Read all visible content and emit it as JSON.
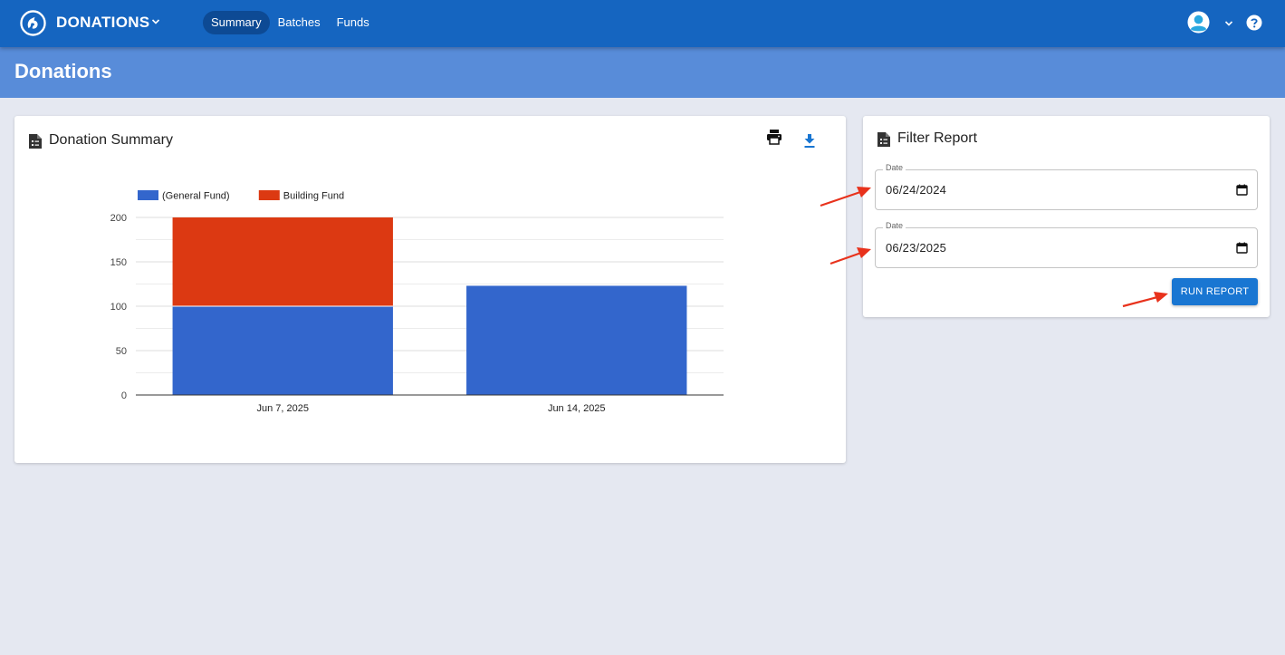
{
  "app": {
    "name": "DONATIONS"
  },
  "nav": {
    "items": [
      {
        "label": "Summary",
        "active": true
      },
      {
        "label": "Batches",
        "active": false
      },
      {
        "label": "Funds",
        "active": false
      }
    ]
  },
  "page": {
    "title": "Donations"
  },
  "summary": {
    "title": "Donation Summary"
  },
  "filter": {
    "title": "Filter Report",
    "start": {
      "label": "Date",
      "value": "06/24/2024"
    },
    "end": {
      "label": "Date",
      "value": "06/23/2025"
    },
    "run_label": "RUN REPORT"
  },
  "colors": {
    "topbar": "#1565c0",
    "subbar": "#588cd9",
    "series1": "#3366cc",
    "series2": "#dc3912",
    "button": "#1976d2",
    "annotation": "#e8321c"
  },
  "chart_data": {
    "type": "bar",
    "stacked": true,
    "categories": [
      "Jun 7, 2025",
      "Jun 14, 2025"
    ],
    "series": [
      {
        "name": "(General Fund)",
        "values": [
          100,
          123
        ],
        "color": "#3366cc"
      },
      {
        "name": "Building Fund",
        "values": [
          100,
          0
        ],
        "color": "#dc3912"
      }
    ],
    "ylim": [
      0,
      200
    ],
    "yticks": [
      0,
      50,
      100,
      150,
      200
    ],
    "grid": true,
    "legend": "top-left"
  }
}
